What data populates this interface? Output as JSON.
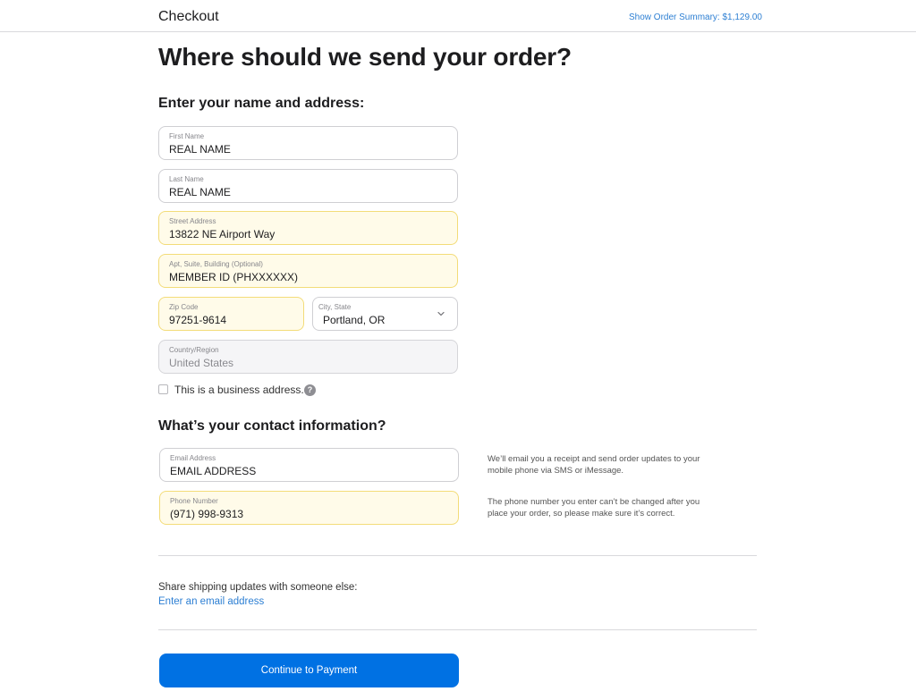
{
  "header": {
    "title": "Checkout",
    "order_summary_link": "Show Order Summary: $1,129.00"
  },
  "page_title": "Where should we send your order?",
  "address_section": {
    "heading": "Enter your name and address:",
    "fields": {
      "first_name": {
        "label": "First Name",
        "value": "REAL NAME"
      },
      "last_name": {
        "label": "Last Name",
        "value": "REAL NAME"
      },
      "street": {
        "label": "Street Address",
        "value": "13822 NE Airport Way"
      },
      "apt": {
        "label": "Apt, Suite, Building (Optional)",
        "value": "MEMBER ID (PHXXXXXX)"
      },
      "zip": {
        "label": "Zip Code",
        "value": "97251-9614"
      },
      "city_state": {
        "label": "City, State",
        "value": "Portland, OR"
      },
      "country": {
        "label": "Country/Region",
        "value": "United States"
      }
    },
    "business_checkbox": {
      "label": "This is a business address.",
      "checked": false,
      "help_icon": "?"
    }
  },
  "contact_section": {
    "heading": "What’s your contact information?",
    "fields": {
      "email": {
        "label": "Email Address",
        "value": "EMAIL ADDRESS"
      },
      "phone": {
        "label": "Phone Number",
        "value": "(971) 998-9313"
      }
    },
    "email_note": "We’ll email you a receipt and send order updates to your mobile phone via SMS or iMessage.",
    "phone_note": "The phone number you enter can’t be changed after you place your order, so please make sure it’s correct."
  },
  "share": {
    "text": "Share shipping updates with someone else:",
    "link": "Enter an email address"
  },
  "continue_button": "Continue to Payment",
  "colors": {
    "accent": "#0071e3",
    "link": "#2d7fd3",
    "autofill_bg": "#fffbe9",
    "autofill_border": "#f3dc79"
  }
}
